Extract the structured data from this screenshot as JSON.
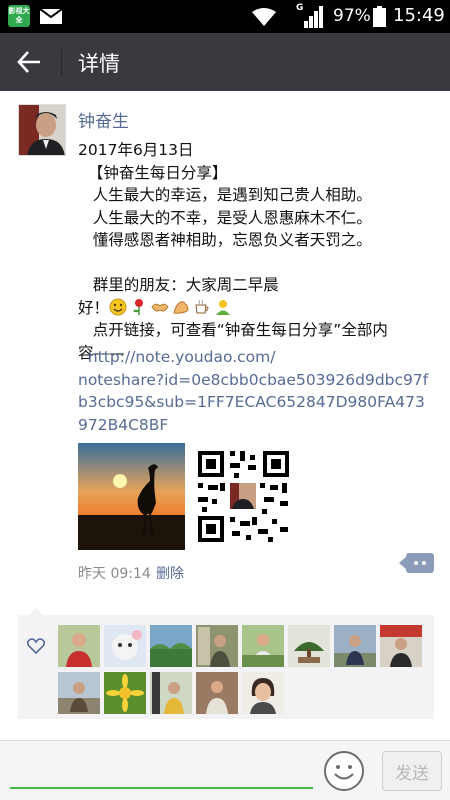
{
  "status_bar": {
    "app_badge": "影视大全",
    "network_label": "G",
    "battery": "97%",
    "time": "15:49"
  },
  "header": {
    "title": "详情"
  },
  "post": {
    "author": "钟奋生",
    "text_lines": [
      "2017年6月13日",
      "  【钟奋生每日分享】",
      "   人生最大的幸运，是遇到知己贵人相助。",
      "   人生最大的不幸，是受人恩惠麻木不仁。",
      "   懂得感恩者神相助，忘恩负义者天罚之。",
      "",
      "   群里的朋友：大家周二早晨",
      "好！"
    ],
    "share_line_1": "   点开链接，可查看“钟奋生每日分享”全部内",
    "share_line_2": "容——",
    "link_lines": [
      "  http://note.youdao.com/",
      "noteshare?id=0e8cbb0cbae503926d9dbc97f",
      "b3cbc95&sub=1FF7ECAC652847D980FA473",
      "972B4C8BF"
    ],
    "emojis": [
      "smile-icon",
      "rose-icon",
      "handshake-icon",
      "strong-icon",
      "coffee-icon",
      "hug-icon"
    ],
    "time": "昨天 09:14",
    "delete_label": "删除"
  },
  "likes": {
    "count": 12
  },
  "input": {
    "send_label": "发送"
  },
  "colors": {
    "accent_link": "#576b95",
    "app_bar": "#393a3f",
    "input_underline": "#47b549"
  }
}
